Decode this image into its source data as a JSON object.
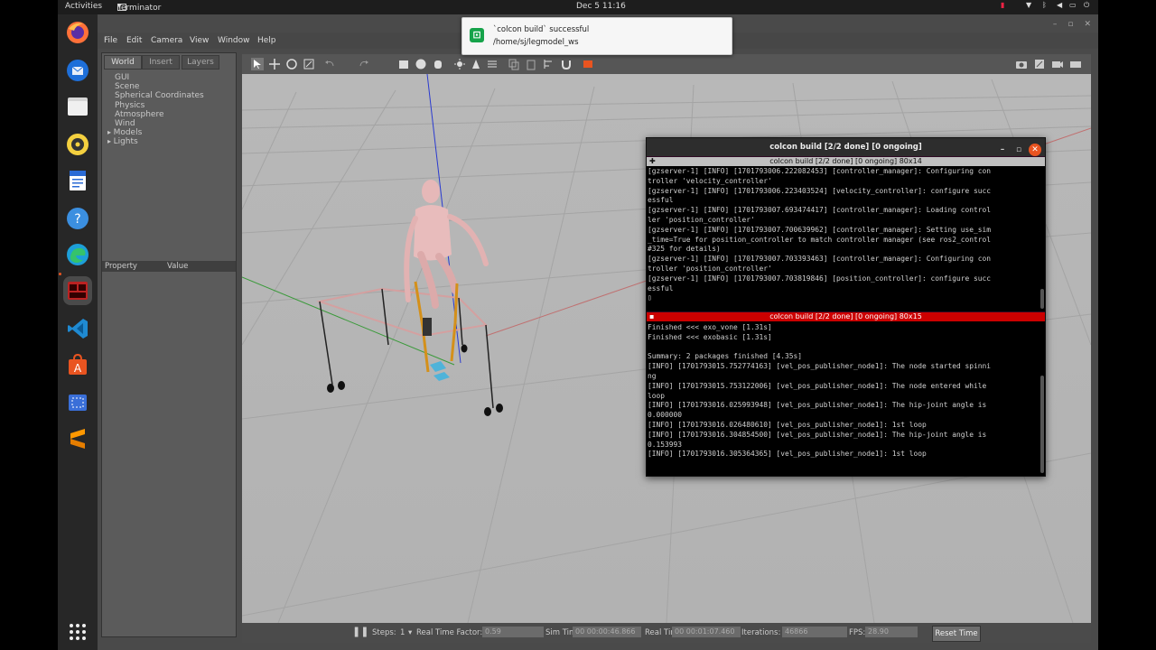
{
  "topbar": {
    "activities": "Activities",
    "app_name": "Terminator",
    "clock": "Dec 5  11:16"
  },
  "dock": {
    "items": [
      {
        "name": "Firefox",
        "icon": "firefox-icon"
      },
      {
        "name": "Thunderbird",
        "icon": "thunderbird-icon"
      },
      {
        "name": "Files",
        "icon": "files-icon"
      },
      {
        "name": "Rhythmbox",
        "icon": "rhythmbox-icon"
      },
      {
        "name": "LibreOffice Writer",
        "icon": "writer-icon"
      },
      {
        "name": "Help",
        "icon": "help-icon"
      },
      {
        "name": "Edge",
        "icon": "edge-icon"
      },
      {
        "name": "Terminator",
        "icon": "terminator-icon"
      },
      {
        "name": "VS Code",
        "icon": "vscode-icon"
      },
      {
        "name": "Software",
        "icon": "software-icon"
      },
      {
        "name": "Screenshot",
        "icon": "screenshot-icon"
      },
      {
        "name": "Sublime",
        "icon": "sublime-icon"
      },
      {
        "name": "Show Applications",
        "icon": "grid-icon"
      }
    ]
  },
  "notification": {
    "title": "`colcon build` successful",
    "body": "/home/sj/legmodel_ws"
  },
  "gazebo": {
    "menu": [
      "File",
      "Edit",
      "Camera",
      "View",
      "Window",
      "Help"
    ],
    "left_tabs": [
      "World",
      "Insert",
      "Layers"
    ],
    "world_items": [
      "GUI",
      "Scene",
      "Spherical Coordinates",
      "Physics",
      "Atmosphere",
      "Wind"
    ],
    "world_expandable": [
      "Models",
      "Lights"
    ],
    "prop_header": {
      "property": "Property",
      "value": "Value"
    },
    "bottom": {
      "steps_label": "Steps:",
      "steps_value": "1",
      "rtf_label": "Real Time Factor:",
      "rtf_value": "0.59",
      "sim_label": "Sim Time:",
      "sim_value": "00 00:00:46.866",
      "real_label": "Real Time:",
      "real_value": "00 00:01:07.460",
      "iter_label": "Iterations:",
      "iter_value": "46866",
      "fps_label": "FPS:",
      "fps_value": "28.90",
      "reset": "Reset Time"
    }
  },
  "terminator": {
    "title": "colcon build [2/2 done] [0 ongoing]",
    "pane1_title": "colcon build [2/2 done] [0 ongoing] 80x14",
    "pane2_title": "colcon build [2/2 done] [0 ongoing] 80x15",
    "pane1_text": "[gzserver-1] [INFO] [1701793006.222082453] [controller_manager]: Configuring con\ntroller 'velocity_controller'\n[gzserver-1] [INFO] [1701793006.223403524] [velocity_controller]: configure succ\nessful\n[gzserver-1] [INFO] [1701793007.693474417] [controller_manager]: Loading control\nler 'position_controller'\n[gzserver-1] [INFO] [1701793007.700639962] [controller_manager]: Setting use_sim\n_time=True for position_controller to match controller manager (see ros2_control\n#325 for details)\n[gzserver-1] [INFO] [1701793007.703393463] [controller_manager]: Configuring con\ntroller 'position_controller'\n[gzserver-1] [INFO] [1701793007.703819846] [position_controller]: configure succ\nessful\n▯",
    "pane2_text": "Finished <<< exo_vone [1.31s]\nFinished <<< exobasic [1.31s]\n\nSummary: 2 packages finished [4.35s]\n[INFO] [1701793015.752774163] [vel_pos_publisher_node1]: The node started spinni\nng\n[INFO] [1701793015.753122006] [vel_pos_publisher_node1]: The node entered while\nloop\n[INFO] [1701793016.025993948] [vel_pos_publisher_node1]: The hip-joint angle is\n0.000000\n[INFO] [1701793016.026480610] [vel_pos_publisher_node1]: 1st loop\n[INFO] [1701793016.304854500] [vel_pos_publisher_node1]: The hip-joint angle is\n0.153993\n[INFO] [1701793016.305364365] [vel_pos_publisher_node1]: 1st loop"
  },
  "colors": {
    "terminal_bg": "#000000",
    "active_pane_bar": "#cc0000",
    "ubuntu_orange": "#e95420",
    "notification_icon": "#16a34a"
  }
}
